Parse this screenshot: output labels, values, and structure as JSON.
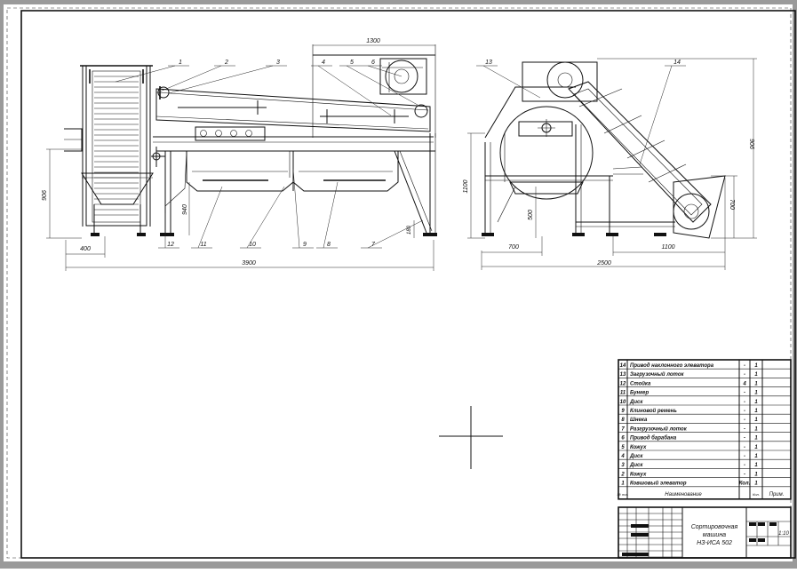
{
  "dimensions": {
    "d1300": "1300",
    "d906a": "906",
    "d940": "940",
    "d180": "180",
    "d400": "400",
    "d3900": "3900",
    "d1100l": "1100",
    "d500": "500",
    "d700": "700",
    "d1100b": "1100",
    "d2500": "2500",
    "d906b": "906",
    "d700v": "700"
  },
  "callouts_left": [
    "1",
    "2",
    "3",
    "4",
    "5",
    "6",
    "7",
    "8",
    "9",
    "10",
    "11",
    "12"
  ],
  "callouts_right": [
    "13",
    "14"
  ],
  "spec_rows": [
    {
      "pos": "14",
      "name": "Привод наклонного элеватора",
      "doc": "-",
      "qty": "1"
    },
    {
      "pos": "13",
      "name": "Загрузочный лоток",
      "doc": "-",
      "qty": "1"
    },
    {
      "pos": "12",
      "name": "Стойка",
      "doc": "4",
      "qty": "1"
    },
    {
      "pos": "11",
      "name": "Бункер",
      "doc": "-",
      "qty": "1"
    },
    {
      "pos": "10",
      "name": "Диск",
      "doc": "-",
      "qty": "1"
    },
    {
      "pos": "9",
      "name": "Клиновой ремень",
      "doc": "-",
      "qty": "1"
    },
    {
      "pos": "8",
      "name": "Шнека",
      "doc": "-",
      "qty": "1"
    },
    {
      "pos": "7",
      "name": "Разгрузочный лоток",
      "doc": "-",
      "qty": "1"
    },
    {
      "pos": "6",
      "name": "Привод барабана",
      "doc": "-",
      "qty": "1"
    },
    {
      "pos": "5",
      "name": "Кожух",
      "doc": "-",
      "qty": "1"
    },
    {
      "pos": "4",
      "name": "Диск",
      "doc": "-",
      "qty": "1"
    },
    {
      "pos": "3",
      "name": "Диск",
      "doc": "-",
      "qty": "1"
    },
    {
      "pos": "2",
      "name": "Кожух",
      "doc": "-",
      "qty": "1"
    },
    {
      "pos": "1",
      "name": "Ковшовый элеватор",
      "doc": "Кол.",
      "qty": "1"
    }
  ],
  "spec_header": {
    "pos": "№ поз.",
    "name": "Наименование",
    "qty": "Кол.",
    "note": "Прим."
  },
  "title_block": {
    "title_line1": "Сортировочная",
    "title_line2": "машина",
    "title_line3": "НЗ-ИСА 502",
    "scale": "1:10"
  }
}
